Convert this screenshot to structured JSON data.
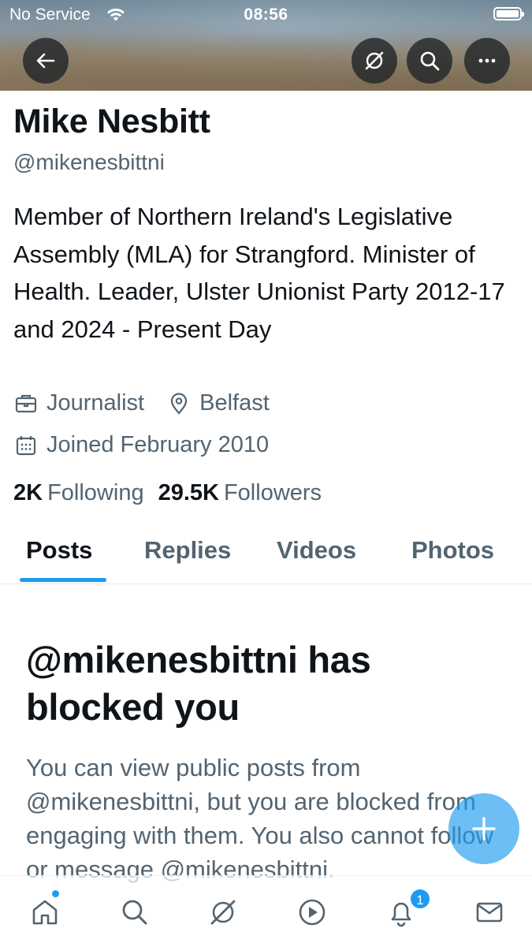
{
  "status_bar": {
    "carrier": "No Service",
    "time": "08:56"
  },
  "profile": {
    "name": "Mike Nesbitt",
    "handle": "@mikenesbittni",
    "bio": "Member of Northern Ireland's Legislative Assembly (MLA) for Strangford. Minister of Health. Leader, Ulster Unionist Party 2012-17 and 2024 - Present Day",
    "profession": "Journalist",
    "location": "Belfast",
    "joined": "Joined February 2010",
    "following_count": "2K",
    "following_label": "Following",
    "followers_count": "29.5K",
    "followers_label": "Followers"
  },
  "tabs": [
    {
      "label": "Posts",
      "active": true
    },
    {
      "label": "Replies",
      "active": false
    },
    {
      "label": "Videos",
      "active": false
    },
    {
      "label": "Photos",
      "active": false
    }
  ],
  "blocked": {
    "title": "@mikenesbittni has blocked you",
    "body": "You can view public posts from @mikenesbittni, but you are blocked from engaging with them. You also cannot follow or message @mikenesbittni."
  },
  "bottom_nav": {
    "items": [
      "home-icon",
      "search-icon",
      "grok-icon",
      "video-icon",
      "notifications-icon",
      "messages-icon"
    ],
    "notification_badge": "1"
  },
  "colors": {
    "accent": "#1d9bf0",
    "text_primary": "#0f1419",
    "text_secondary": "#536471"
  }
}
